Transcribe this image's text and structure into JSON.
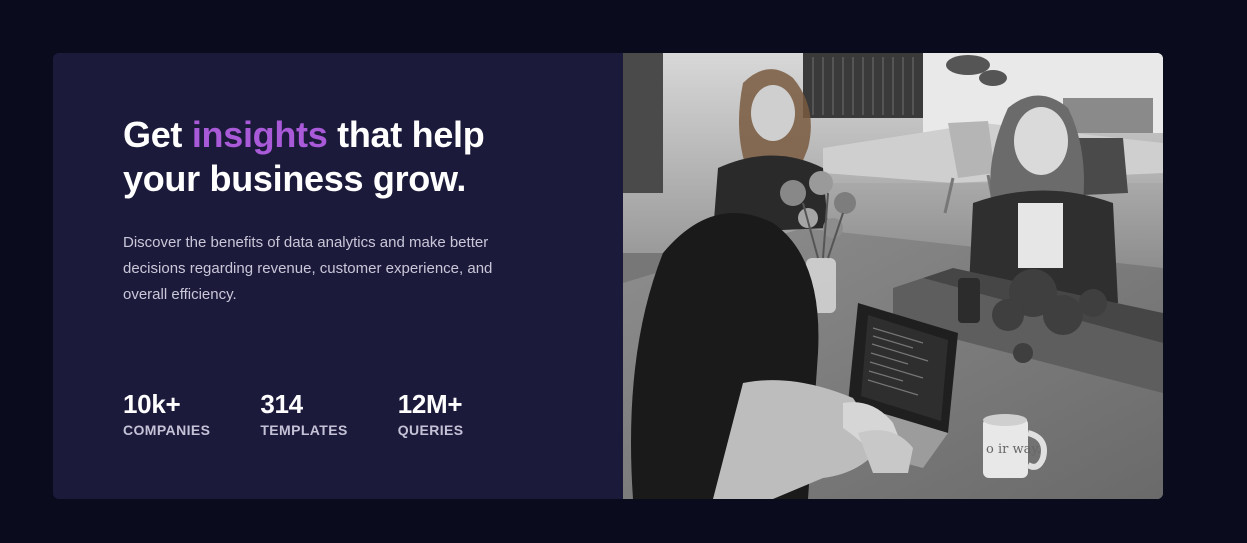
{
  "hero": {
    "heading_pre": "Get ",
    "heading_accent": "insights",
    "heading_post": " that help your business grow.",
    "description": "Discover the benefits of data analytics and make better decisions regarding revenue, customer experience, and overall efficiency."
  },
  "stats": [
    {
      "value": "10k+",
      "label": "COMPANIES"
    },
    {
      "value": "314",
      "label": "TEMPLATES"
    },
    {
      "value": "12M+",
      "label": "QUERIES"
    }
  ],
  "photo": {
    "mug_text": "o ir way."
  },
  "colors": {
    "page_bg": "#0a0c1e",
    "card_bg": "#1c1a3b",
    "accent": "#a95ad9"
  }
}
